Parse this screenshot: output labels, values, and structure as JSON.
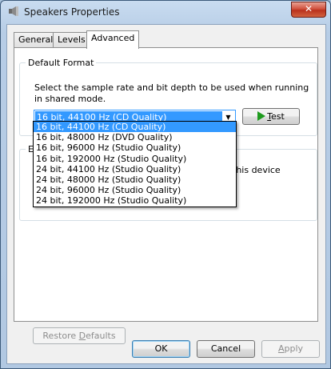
{
  "window": {
    "title": "Speakers Properties",
    "close_glyph": "✕"
  },
  "tabs": [
    {
      "label": "General",
      "active": false
    },
    {
      "label": "Levels",
      "active": false
    },
    {
      "label": "Advanced",
      "active": true
    }
  ],
  "default_format": {
    "group_label": "Default Format",
    "description": "Select the sample rate and bit depth to be used when running in shared mode.",
    "selected": "16 bit, 44100 Hz (CD Quality)",
    "test_button": {
      "accel": "T",
      "rest": "est"
    },
    "options": [
      "16 bit, 44100 Hz (CD Quality)",
      "16 bit, 48000 Hz (DVD Quality)",
      "16 bit, 96000 Hz (Studio Quality)",
      "16 bit, 192000 Hz (Studio Quality)",
      "24 bit, 44100 Hz (Studio Quality)",
      "24 bit, 48000 Hz (Studio Quality)",
      "24 bit, 96000 Hz (Studio Quality)",
      "24 bit, 192000 Hz (Studio Quality)"
    ]
  },
  "exclusive_mode": {
    "group_label_partial": "E",
    "text_partial": "this device"
  },
  "restore_defaults": {
    "pre": "Restore ",
    "accel": "D",
    "post": "efaults"
  },
  "footer": {
    "ok": "OK",
    "cancel": "Cancel",
    "apply_accel": "A",
    "apply_rest": "pply"
  },
  "colors": {
    "selection": "#3399ff",
    "play": "#1e9b1e",
    "close": "#c7412c"
  }
}
